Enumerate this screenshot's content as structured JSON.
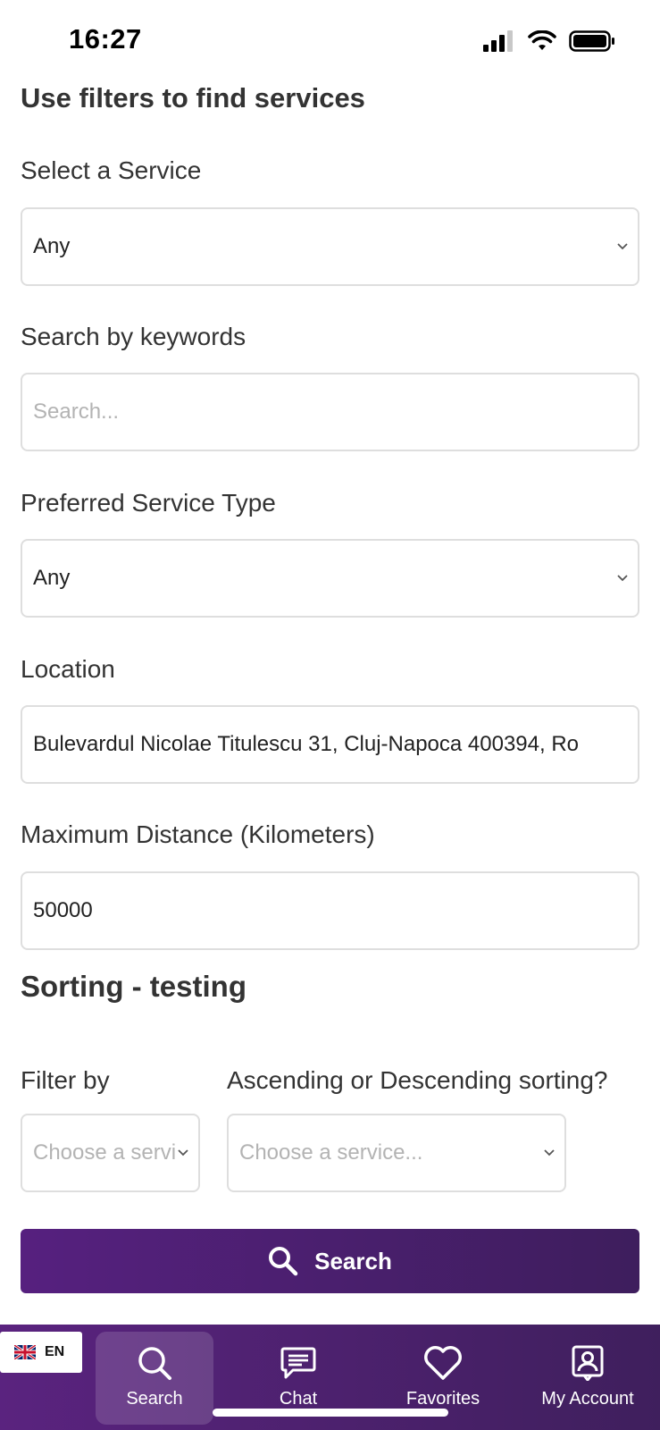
{
  "status": {
    "time": "16:27"
  },
  "page_title": "Use filters to find services",
  "filters": {
    "service": {
      "label": "Select a Service",
      "value": "Any"
    },
    "keywords": {
      "label": "Search by keywords",
      "placeholder": "Search..."
    },
    "service_type": {
      "label": "Preferred Service Type",
      "value": "Any"
    },
    "location": {
      "label": "Location",
      "value": "Bulevardul Nicolae Titulescu 31, Cluj-Napoca 400394, Ro"
    },
    "distance": {
      "label": "Maximum Distance (Kilometers)",
      "value": "50000"
    }
  },
  "sorting": {
    "title": "Sorting - testing",
    "filter_by": {
      "label": "Filter by",
      "placeholder": "Choose a servi"
    },
    "order": {
      "label": "Ascending or Descending sorting?",
      "placeholder": "Choose a service..."
    }
  },
  "search_button": {
    "label": "Search",
    "icon": "search-icon"
  },
  "language": {
    "code": "EN",
    "icon": "uk-flag-icon"
  },
  "nav": {
    "active": "Search",
    "items": [
      {
        "label": "Search",
        "icon": "search-icon"
      },
      {
        "label": "Chat",
        "icon": "chat-icon"
      },
      {
        "label": "Favorites",
        "icon": "heart-icon"
      },
      {
        "label": "My Account",
        "icon": "account-icon"
      }
    ]
  },
  "colors": {
    "brand": "#56207f",
    "brand_dark": "#3e1e5d",
    "text": "#333333",
    "border": "#dedede"
  }
}
